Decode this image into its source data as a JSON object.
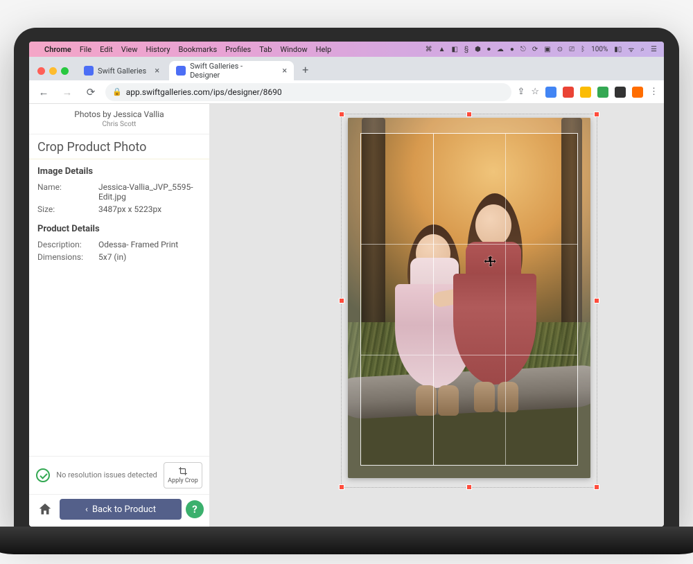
{
  "menubar": {
    "browser": "Chrome",
    "items": [
      "File",
      "Edit",
      "View",
      "History",
      "Bookmarks",
      "Profiles",
      "Tab",
      "Window",
      "Help"
    ],
    "battery": "100%"
  },
  "tabs": {
    "inactive": {
      "title": "Swift Galleries"
    },
    "active": {
      "title": "Swift Galleries - Designer"
    }
  },
  "omnibox": {
    "url": "app.swiftgalleries.com/ips/designer/8690"
  },
  "sidebar": {
    "photographer": "Photos by Jessica Vallia",
    "client": "Chris Scott",
    "panel_title": "Crop Product Photo",
    "image_details_heading": "Image Details",
    "image": {
      "name_label": "Name:",
      "name_value": "Jessica-Vallia_JVP_5595-Edit.jpg",
      "size_label": "Size:",
      "size_value": "3487px x 5223px"
    },
    "product_details_heading": "Product Details",
    "product": {
      "desc_label": "Description:",
      "desc_value": "Odessa- Framed Print",
      "dim_label": "Dimensions:",
      "dim_value": "5x7 (in)"
    },
    "status_text": "No resolution issues detected",
    "apply_crop_label": "Apply Crop",
    "back_label": "Back to Product"
  }
}
